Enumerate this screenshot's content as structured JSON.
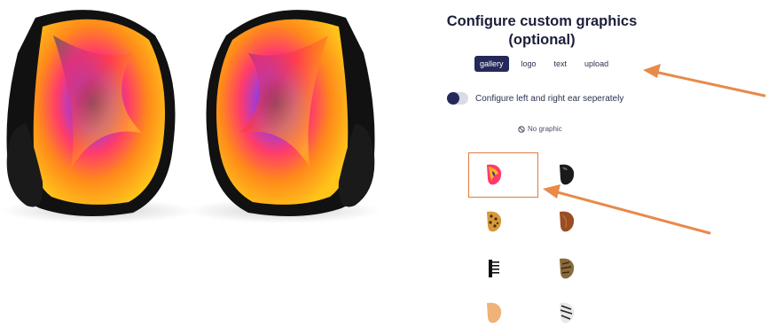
{
  "panel": {
    "title_line1": "Configure custom graphics",
    "title_line2": "(optional)",
    "tabs": [
      {
        "label": "gallery",
        "active": true
      },
      {
        "label": "logo",
        "active": false
      },
      {
        "label": "text",
        "active": false
      },
      {
        "label": "upload",
        "active": false
      }
    ],
    "toggle_label": "Configure left and right ear seperately",
    "toggle_on": false,
    "no_graphic_label": "No graphic",
    "gallery_items": [
      {
        "name": "rainbow-swirl",
        "selected": true
      },
      {
        "name": "black-gloss",
        "selected": false
      },
      {
        "name": "leopard",
        "selected": false
      },
      {
        "name": "wood",
        "selected": false
      },
      {
        "name": "comb",
        "selected": false
      },
      {
        "name": "snake",
        "selected": false
      },
      {
        "name": "light-wood",
        "selected": false
      },
      {
        "name": "zebra",
        "selected": false
      }
    ]
  },
  "colors": {
    "accent": "#24285a",
    "highlight": "#e07a3c",
    "annotation_arrow": "#e88a4a"
  }
}
